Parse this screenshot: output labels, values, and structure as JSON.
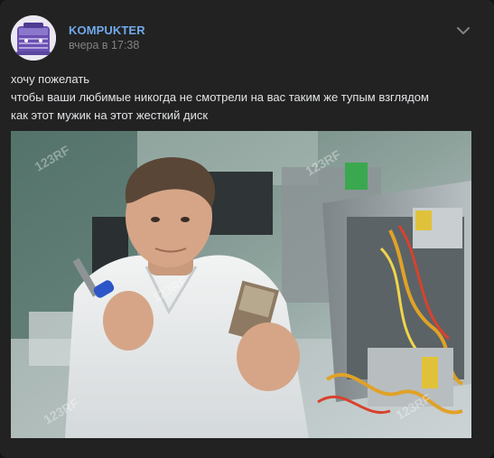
{
  "post": {
    "author": "KOMPUKTER",
    "timestamp": "вчера в 17:38",
    "text_lines": [
      "хочу пожелать",
      "чтобы ваши любимые никогда не смотрели на вас таким же тупым взглядом",
      "как этот мужик на этот жесткий диск"
    ],
    "watermark": "123RF"
  },
  "colors": {
    "card_bg": "#222222",
    "author": "#71aaeb",
    "meta": "#828282",
    "text": "#e1e3e6",
    "icon": "#828282"
  },
  "icons": {
    "menu": "chevron-down-icon"
  }
}
